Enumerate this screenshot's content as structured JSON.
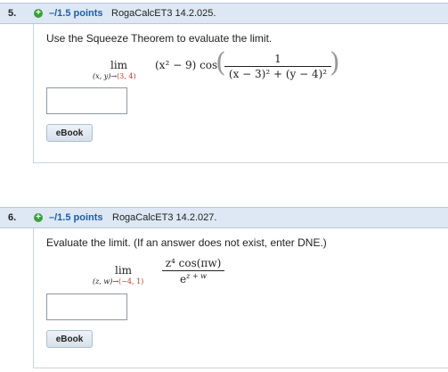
{
  "questions": [
    {
      "number": "5.",
      "points": "–/1.5 points",
      "source": "RogaCalcET3 14.2.025.",
      "prompt": "Use the Squeeze Theorem to evaluate the limit.",
      "limit": {
        "lim": "lim",
        "approach_vars": "(x, y)",
        "arrow": "→",
        "approach_point": "(3, 4)",
        "factor": "(x² − 9) cos",
        "numerator": "1",
        "denominator": "(x − 3)² + (y − 4)²"
      },
      "answer_value": "",
      "ebook": "eBook"
    },
    {
      "number": "6.",
      "points": "–/1.5 points",
      "source": "RogaCalcET3 14.2.027.",
      "prompt": "Evaluate the limit. (If an answer does not exist, enter DNE.)",
      "limit": {
        "lim": "lim",
        "approach_vars": "(z, w)",
        "arrow": "→",
        "approach_point": "(−4, 1)",
        "numerator": "z⁴ cos(πw)",
        "denominator": "e^z + w",
        "denominator_base": "e",
        "denominator_exp": "z + w"
      },
      "answer_value": "",
      "ebook": "eBook"
    }
  ]
}
